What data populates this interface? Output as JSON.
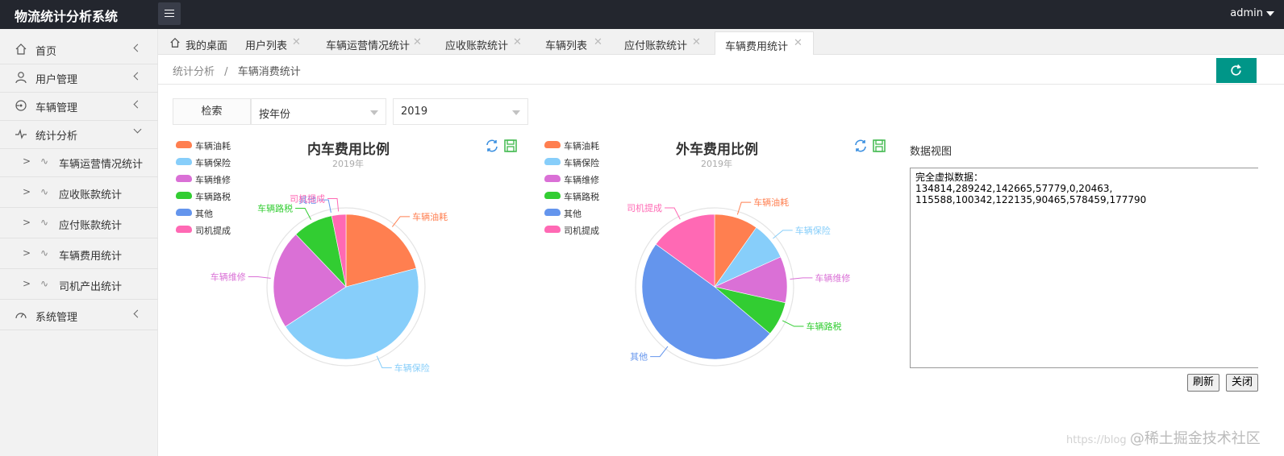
{
  "app": {
    "title": "物流统计分析系统",
    "user": "admin"
  },
  "sidebar": {
    "items": [
      {
        "label": "首页",
        "icon": "home-icon"
      },
      {
        "label": "用户管理",
        "icon": "user-icon"
      },
      {
        "label": "车辆管理",
        "icon": "car-icon"
      },
      {
        "label": "统计分析",
        "icon": "pulse-icon"
      },
      {
        "label": "系统管理",
        "icon": "dashboard-icon"
      }
    ],
    "sub_items": [
      {
        "label": "车辆运营情况统计"
      },
      {
        "label": "应收账款统计"
      },
      {
        "label": "应付账款统计"
      },
      {
        "label": "车辆费用统计"
      },
      {
        "label": "司机产出统计"
      }
    ]
  },
  "tabs": [
    {
      "label": "我的桌面",
      "icon": "home-icon"
    },
    {
      "label": "用户列表"
    },
    {
      "label": "车辆运营情况统计"
    },
    {
      "label": "应收账款统计"
    },
    {
      "label": "车辆列表"
    },
    {
      "label": "应付账款统计"
    },
    {
      "label": "车辆费用统计",
      "active": true
    }
  ],
  "breadcrumb": {
    "parent": "统计分析",
    "separator": "/",
    "current": "车辆消费统计"
  },
  "filter": {
    "label": "检索",
    "mode": "按年份",
    "year": "2019"
  },
  "chart_data": [
    {
      "type": "pie",
      "title": "内车费用比例",
      "subtitle": "2019年",
      "categories": [
        "车辆油耗",
        "车辆保险",
        "车辆维修",
        "车辆路税",
        "其他",
        "司机提成"
      ],
      "values": [
        134814,
        289242,
        142665,
        57779,
        0,
        20463
      ],
      "colors": [
        "#ff7f50",
        "#87cefa",
        "#da70d6",
        "#32cd32",
        "#6495ed",
        "#ff69b4"
      ],
      "legend": "top-left"
    },
    {
      "type": "pie",
      "title": "外车费用比例",
      "subtitle": "2019年",
      "categories": [
        "车辆油耗",
        "车辆保险",
        "车辆维修",
        "车辆路税",
        "其他",
        "司机提成"
      ],
      "values": [
        115588,
        100342,
        122135,
        90465,
        578459,
        177790
      ],
      "colors": [
        "#ff7f50",
        "#87cefa",
        "#da70d6",
        "#32cd32",
        "#6495ed",
        "#ff69b4"
      ],
      "legend": "top-left"
    }
  ],
  "data_view": {
    "title": "数据视图",
    "content": "完全虚拟数据：\n134814,289242,142665,57779,0,20463,\n115588,100342,122135,90465,578459,177790",
    "refresh_label": "刷新",
    "close_label": "关闭"
  },
  "watermark": {
    "prefix": "https://blog",
    "brand": "@稀土掘金技术社区"
  },
  "colors": {
    "topbar": "#23262e",
    "accent": "#009688",
    "sidebar": "#f2f2f2"
  }
}
